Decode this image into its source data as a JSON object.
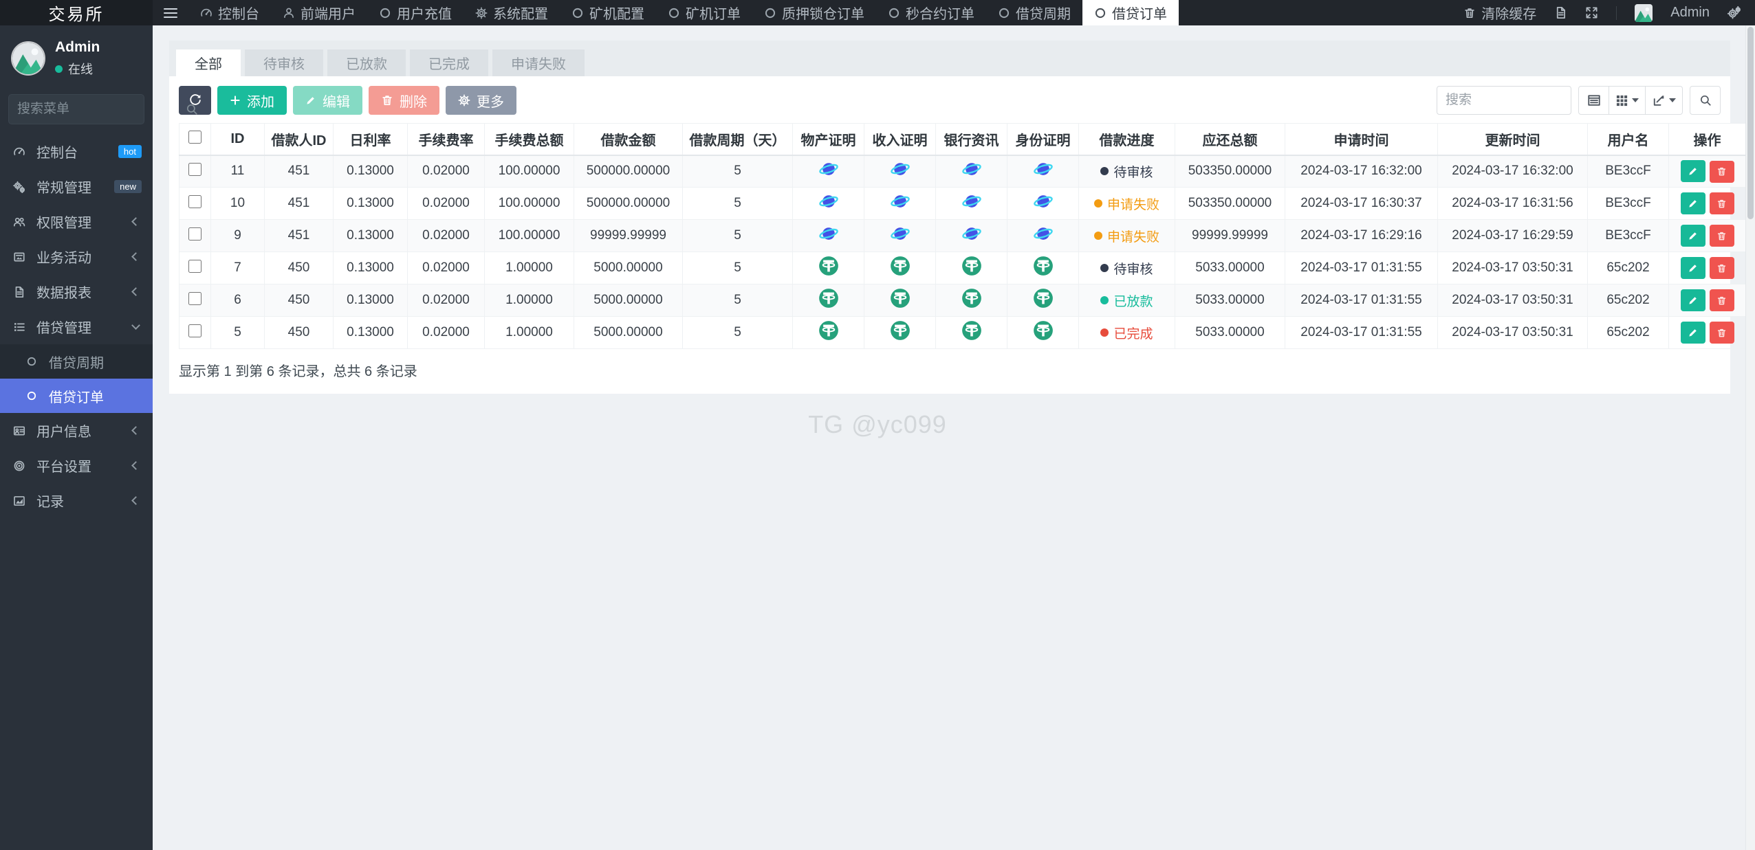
{
  "topbar": {
    "brand": "交易所",
    "nav": [
      {
        "label": "控制台",
        "icon": "dashboard"
      },
      {
        "label": "前端用户",
        "icon": "user"
      },
      {
        "label": "用户充值",
        "icon": "circle"
      },
      {
        "label": "系统配置",
        "icon": "gear"
      },
      {
        "label": "矿机配置",
        "icon": "circle"
      },
      {
        "label": "矿机订单",
        "icon": "circle"
      },
      {
        "label": "质押锁仓订单",
        "icon": "circle"
      },
      {
        "label": "秒合约订单",
        "icon": "circle"
      },
      {
        "label": "借贷周期",
        "icon": "circle"
      },
      {
        "label": "借贷订单",
        "icon": "circle",
        "active": true
      }
    ],
    "clear_cache_label": "清除缓存",
    "username": "Admin"
  },
  "sidebar": {
    "user": {
      "name": "Admin",
      "status": "在线"
    },
    "search_placeholder": "搜索菜单",
    "items": [
      {
        "label": "控制台",
        "icon": "dashboard",
        "badge": "hot"
      },
      {
        "label": "常规管理",
        "icon": "gears",
        "badge": "new"
      },
      {
        "label": "权限管理",
        "icon": "users",
        "chevron": true
      },
      {
        "label": "业务活动",
        "icon": "news",
        "chevron": true
      },
      {
        "label": "数据报表",
        "icon": "file",
        "chevron": true
      },
      {
        "label": "借贷管理",
        "icon": "list",
        "expanded": true,
        "children": [
          {
            "label": "借贷周期"
          },
          {
            "label": "借贷订单",
            "active": true
          }
        ]
      },
      {
        "label": "用户信息",
        "icon": "idcard",
        "chevron": true
      },
      {
        "label": "平台设置",
        "icon": "target",
        "chevron": true
      },
      {
        "label": "记录",
        "icon": "chart",
        "chevron": true
      }
    ]
  },
  "tabs": {
    "items": [
      "全部",
      "待审核",
      "已放款",
      "已完成",
      "申请失败"
    ],
    "active_index": 0
  },
  "toolbar": {
    "add": "添加",
    "edit": "编辑",
    "delete": "删除",
    "more": "更多",
    "search_placeholder": "搜索"
  },
  "table": {
    "headers": [
      "ID",
      "借款人ID",
      "日利率",
      "手续费率",
      "手续费总额",
      "借款金额",
      "借款周期（天）",
      "物产证明",
      "收入证明",
      "银行资讯",
      "身份证明",
      "借款进度",
      "应还总额",
      "申请时间",
      "更新时间",
      "用户名",
      "操作"
    ],
    "rows": [
      {
        "id": "11",
        "borrower_id": "451",
        "daily_rate": "0.13000",
        "fee_rate": "0.02000",
        "fee_total": "100.00000",
        "amount": "500000.00000",
        "period": "5",
        "proof_icon": "planet",
        "status": {
          "label": "待审核",
          "type": "pending"
        },
        "repay": "503350.00000",
        "apply_time": "2024-03-17 16:32:00",
        "update_time": "2024-03-17 16:32:00",
        "username": "BE3ccF"
      },
      {
        "id": "10",
        "borrower_id": "451",
        "daily_rate": "0.13000",
        "fee_rate": "0.02000",
        "fee_total": "100.00000",
        "amount": "500000.00000",
        "period": "5",
        "proof_icon": "planet",
        "status": {
          "label": "申请失败",
          "type": "failed"
        },
        "repay": "503350.00000",
        "apply_time": "2024-03-17 16:30:37",
        "update_time": "2024-03-17 16:31:56",
        "username": "BE3ccF"
      },
      {
        "id": "9",
        "borrower_id": "451",
        "daily_rate": "0.13000",
        "fee_rate": "0.02000",
        "fee_total": "100.00000",
        "amount": "99999.99999",
        "period": "5",
        "proof_icon": "planet",
        "status": {
          "label": "申请失败",
          "type": "failed"
        },
        "repay": "99999.99999",
        "apply_time": "2024-03-17 16:29:16",
        "update_time": "2024-03-17 16:29:59",
        "username": "BE3ccF"
      },
      {
        "id": "7",
        "borrower_id": "450",
        "daily_rate": "0.13000",
        "fee_rate": "0.02000",
        "fee_total": "1.00000",
        "amount": "5000.00000",
        "period": "5",
        "proof_icon": "tether",
        "status": {
          "label": "待审核",
          "type": "pending"
        },
        "repay": "5033.00000",
        "apply_time": "2024-03-17 01:31:55",
        "update_time": "2024-03-17 03:50:31",
        "username": "65c202"
      },
      {
        "id": "6",
        "borrower_id": "450",
        "daily_rate": "0.13000",
        "fee_rate": "0.02000",
        "fee_total": "1.00000",
        "amount": "5000.00000",
        "period": "5",
        "proof_icon": "tether",
        "status": {
          "label": "已放款",
          "type": "loaned"
        },
        "repay": "5033.00000",
        "apply_time": "2024-03-17 01:31:55",
        "update_time": "2024-03-17 03:50:31",
        "username": "65c202"
      },
      {
        "id": "5",
        "borrower_id": "450",
        "daily_rate": "0.13000",
        "fee_rate": "0.02000",
        "fee_total": "1.00000",
        "amount": "5000.00000",
        "period": "5",
        "proof_icon": "tether",
        "status": {
          "label": "已完成",
          "type": "done"
        },
        "repay": "5033.00000",
        "apply_time": "2024-03-17 01:31:55",
        "update_time": "2024-03-17 03:50:31",
        "username": "65c202"
      }
    ]
  },
  "footer": {
    "summary": "显示第 1 到第 6 条记录，总共 6 条记录"
  },
  "watermark": "TG @yc099",
  "colors": {
    "status": {
      "pending": "#333c4e",
      "failed": "#f39c12",
      "loaned": "#18bc9c",
      "done": "#e74c3c"
    },
    "accent_blue": "#5b73e0",
    "add_green": "#1abc9c",
    "delete_red": "#f0544f",
    "badge_hot": "#1e9bf7",
    "badge_new": "#3e4f63",
    "tether_green": "#26a17b",
    "planet_blue": "#4452e6"
  }
}
